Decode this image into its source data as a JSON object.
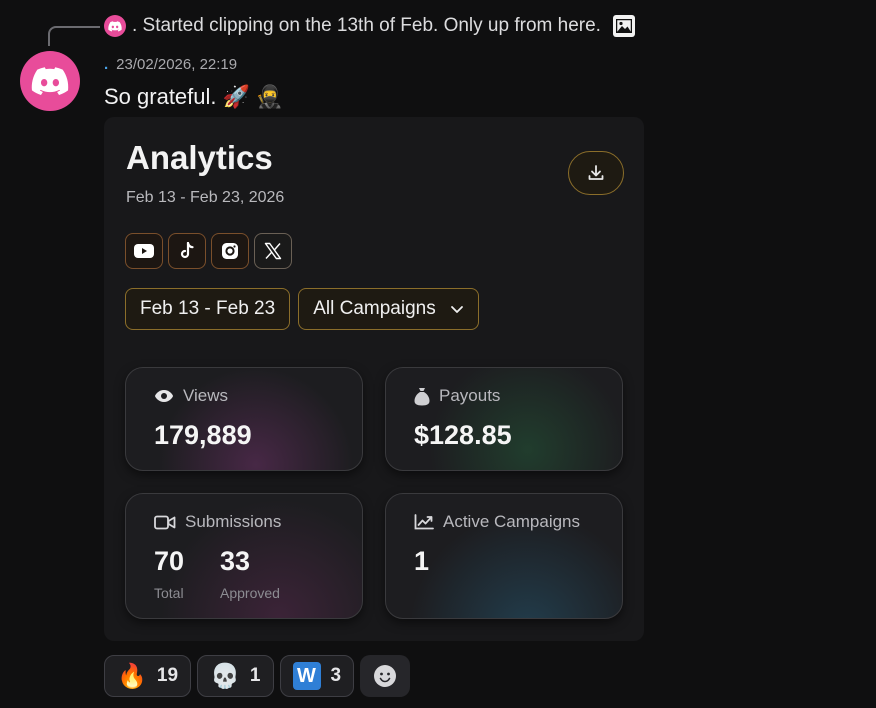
{
  "reply": {
    "text": ". Started clipping on the 13th of Feb.  Only up from here.",
    "avatar_icon": "discord-logo-icon",
    "attachment_icon": "image-icon"
  },
  "message": {
    "avatar_icon": "discord-logo-icon",
    "avatar_color": "#e84c9a",
    "author_dot": ".",
    "timestamp": "23/02/2026, 22:19",
    "text": "So grateful.",
    "emojis": [
      "🚀",
      "🥷"
    ]
  },
  "card": {
    "title": "Analytics",
    "date_range": "Feb 13 - Feb 23, 2026",
    "download_icon": "download-icon",
    "platforms": [
      "youtube-icon",
      "tiktok-icon",
      "instagram-icon",
      "x-icon"
    ],
    "filters": {
      "date_label": "Feb 13 - Feb 23",
      "campaign_label": "All Campaigns"
    },
    "stats": {
      "views": {
        "label": "Views",
        "value": "179,889",
        "icon": "eye-icon"
      },
      "payouts": {
        "label": "Payouts",
        "value": "$128.85",
        "icon": "money-bag-icon"
      },
      "submissions": {
        "label": "Submissions",
        "icon": "video-camera-icon",
        "total": "70",
        "total_label": "Total",
        "approved": "33",
        "approved_label": "Approved"
      },
      "active_campaigns": {
        "label": "Active Campaigns",
        "value": "1",
        "icon": "trend-chart-icon"
      }
    },
    "accent_color": "#8b6e2a"
  },
  "reactions": [
    {
      "emoji": "🔥",
      "count": "19"
    },
    {
      "emoji": "💀",
      "count": "1"
    },
    {
      "emoji": "W",
      "count": "3"
    }
  ],
  "add_reaction_icon": "smiley-add-icon"
}
